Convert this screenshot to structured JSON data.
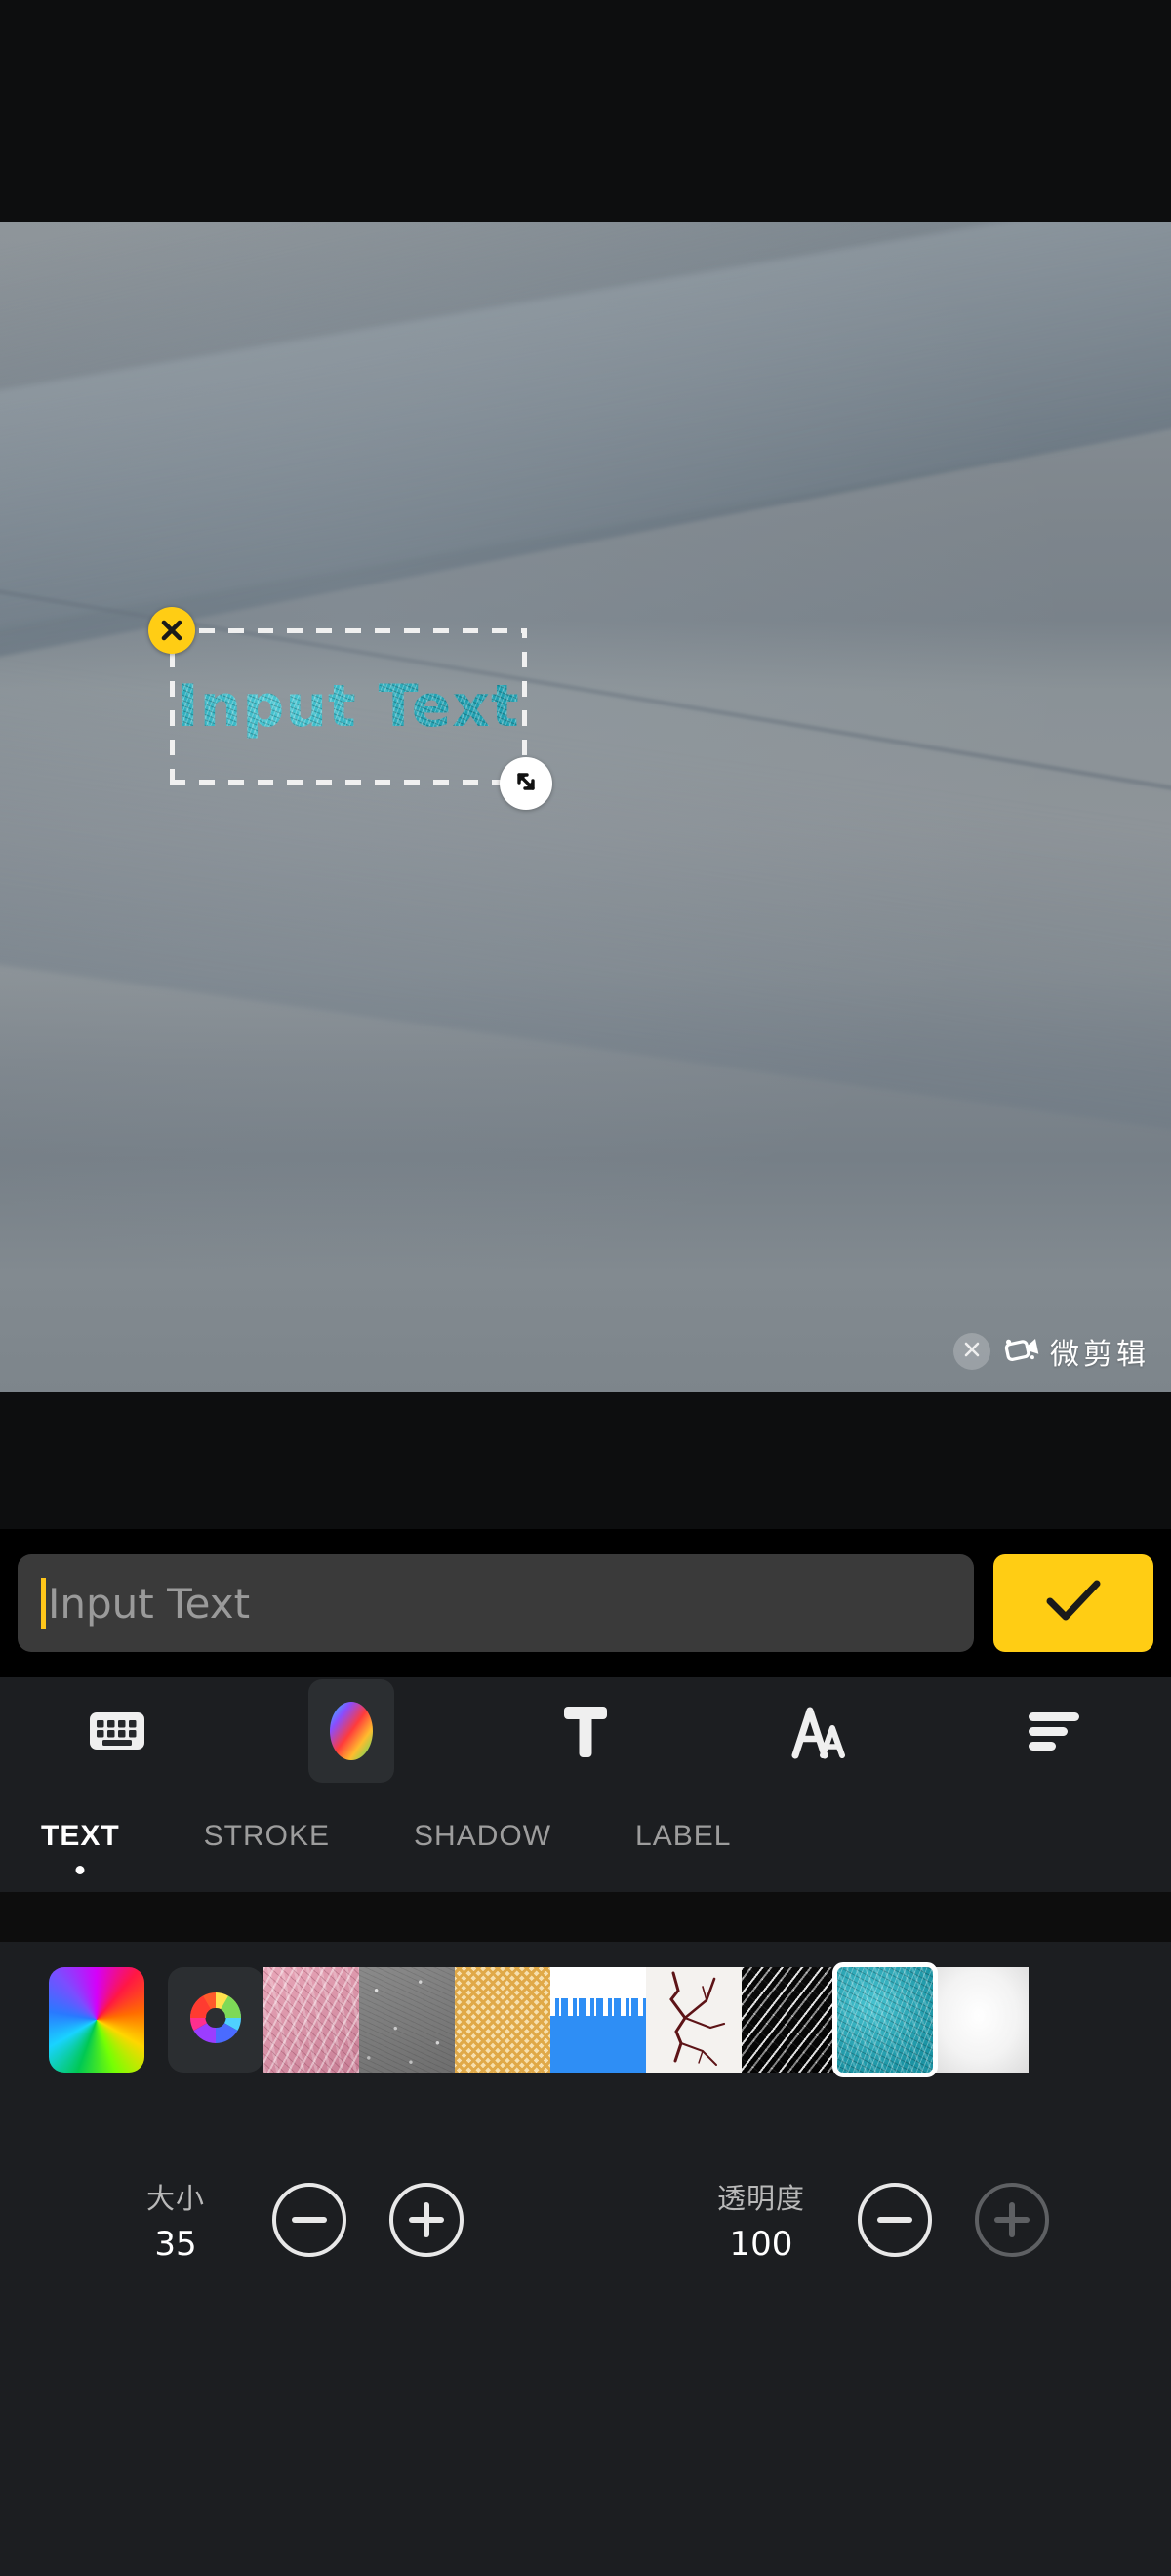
{
  "app": {
    "watermark_brand": "微剪辑",
    "watermark_close_icon": "close-icon",
    "watermark_brand_icon": "video-camera-icon"
  },
  "canvas": {
    "text_object": {
      "content": "Input Text",
      "delete_icon": "close-x-icon",
      "resize_icon": "resize-diagonal-icon",
      "fill_color": "#2ab5c4",
      "style": "teal-crumple-texture"
    }
  },
  "input_row": {
    "placeholder": "Input Text",
    "value": "",
    "caret_color": "#ffc61a",
    "confirm_label": "",
    "confirm_icon": "check-icon",
    "confirm_color": "#ffcd14"
  },
  "icon_toolbar": {
    "items": [
      {
        "name": "keyboard",
        "icon": "keyboard-icon",
        "active": false
      },
      {
        "name": "color",
        "icon": "color-wheel-icon",
        "active": true
      },
      {
        "name": "font",
        "icon": "text-t-icon",
        "active": false
      },
      {
        "name": "font-size",
        "icon": "font-size-aa-icon",
        "active": false
      },
      {
        "name": "align",
        "icon": "align-lines-icon",
        "active": false
      }
    ]
  },
  "tabs": {
    "items": [
      {
        "label": "TEXT",
        "active": true
      },
      {
        "label": "STROKE",
        "active": false
      },
      {
        "label": "SHADOW",
        "active": false
      },
      {
        "label": "LABEL",
        "active": false
      }
    ]
  },
  "swatches": {
    "items": [
      {
        "name": "rainbow-gradient",
        "type": "gradient",
        "selected": false
      },
      {
        "name": "color-picker",
        "type": "picker",
        "selected": false
      },
      {
        "name": "crumpled-pink-paper",
        "type": "texture",
        "selected": false
      },
      {
        "name": "grey-concrete",
        "type": "texture",
        "selected": false
      },
      {
        "name": "yellow-squiggle",
        "type": "texture",
        "selected": false
      },
      {
        "name": "blue-wave",
        "type": "texture",
        "selected": false
      },
      {
        "name": "white-crack",
        "type": "texture",
        "selected": false
      },
      {
        "name": "black-foil",
        "type": "texture",
        "selected": false
      },
      {
        "name": "teal-crumple",
        "type": "texture",
        "selected": true
      },
      {
        "name": "white-gloss",
        "type": "texture",
        "selected": false
      }
    ]
  },
  "steppers": {
    "size": {
      "label": "大小",
      "value": "35",
      "minus_enabled": true,
      "plus_enabled": true
    },
    "opacity": {
      "label": "透明度",
      "value": "100",
      "minus_enabled": true,
      "plus_enabled": false
    }
  }
}
